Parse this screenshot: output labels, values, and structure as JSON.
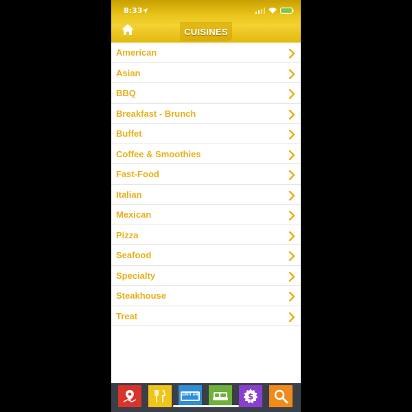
{
  "status": {
    "time": "8:33"
  },
  "header": {
    "title": "CUISINES"
  },
  "cuisines": [
    "American",
    "Asian",
    "BBQ",
    "Breakfast - Brunch",
    "Buffet",
    "Coffee & Smoothies",
    "Fast-Food",
    "Italian",
    "Mexican",
    "Pizza",
    "Seafood",
    "Specialty",
    "Steakhouse",
    "Treat"
  ],
  "tabs": [
    {
      "icon": "map-pin-icon",
      "color": "#d9342b"
    },
    {
      "icon": "fork-knife-icon",
      "color": "#f0c419"
    },
    {
      "icon": "ticket-icon",
      "color": "#2e8fd6",
      "text": "ADMIT ONE"
    },
    {
      "icon": "bed-icon",
      "color": "#6fb23a"
    },
    {
      "icon": "dollar-icon",
      "color": "#8b3fd1"
    },
    {
      "icon": "search-icon",
      "color": "#f08a1c"
    }
  ],
  "colors": {
    "accent": "#e8b018",
    "tab_bar": "#3b3f47"
  }
}
